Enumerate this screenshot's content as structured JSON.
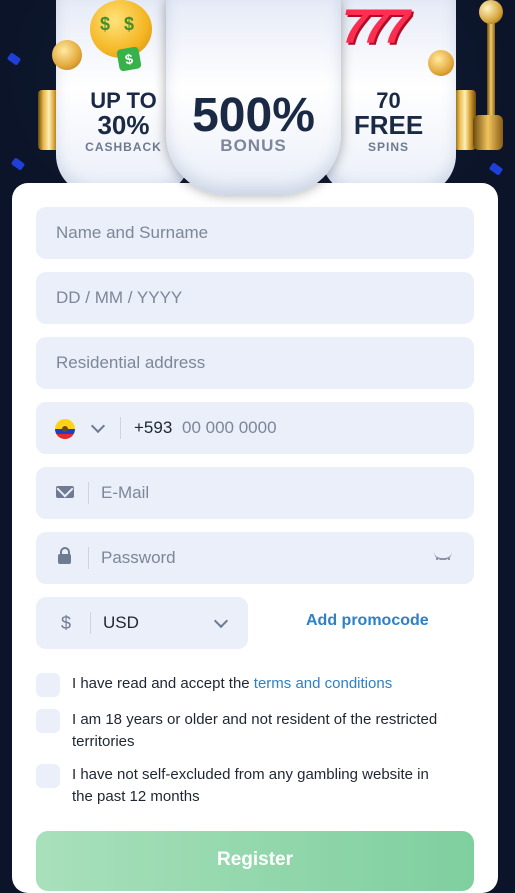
{
  "banner": {
    "left": {
      "line1": "UP TO",
      "line2": "30%",
      "caption": "CASHBACK"
    },
    "center": {
      "headline": "500%",
      "caption": "BONUS"
    },
    "right": {
      "line1": "70",
      "line2": "FREE",
      "caption": "SPINS"
    }
  },
  "form": {
    "name_placeholder": "Name and Surname",
    "dob_placeholder": "DD / MM / YYYY",
    "address_placeholder": "Residential address",
    "phone": {
      "country_code": "+593",
      "placeholder": "00 000 0000",
      "flag": "ecuador-flag-icon"
    },
    "email_placeholder": "E-Mail",
    "password_placeholder": "Password",
    "currency": {
      "symbol": "$",
      "selected": "USD"
    },
    "promo_link": "Add promocode",
    "checks": [
      {
        "text": "I have read and accept the ",
        "link": "terms and conditions"
      },
      {
        "text": "I am 18 years or older and not resident of the restricted territories"
      },
      {
        "text": "I have not self-excluded from any gambling website in the past 12 months"
      }
    ],
    "register_label": "Register"
  },
  "colors": {
    "background": "#0b1428",
    "field": "#eaeff9",
    "link": "#2e80c7",
    "register_button": "#7fcf9f"
  }
}
